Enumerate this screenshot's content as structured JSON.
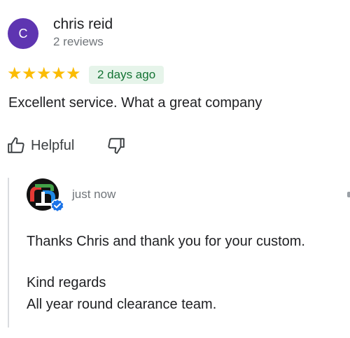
{
  "colors": {
    "avatar_bg": "#5e35b1",
    "star": "#fbbc04",
    "badge_bg": "#e6f4ea",
    "badge_text": "#137333",
    "verified": "#1a73e8"
  },
  "review": {
    "avatar_initial": "C",
    "reviewer_name": "chris reid",
    "review_count": "2 reviews",
    "rating": 5,
    "max_rating": 5,
    "date": "2 days ago",
    "text": "Excellent service. What a great company",
    "helpful_label": "Helpful",
    "icons": {
      "helpful": "thumbs-up-icon",
      "not_helpful": "thumbs-down-icon"
    }
  },
  "reply": {
    "time": "just now",
    "logo_icon": "business-logo-icon",
    "badge_icon": "verified-check-icon",
    "line1": "Thanks Chris and thank you for your custom.",
    "line2": "Kind regards",
    "line3": "All year round clearance team."
  }
}
